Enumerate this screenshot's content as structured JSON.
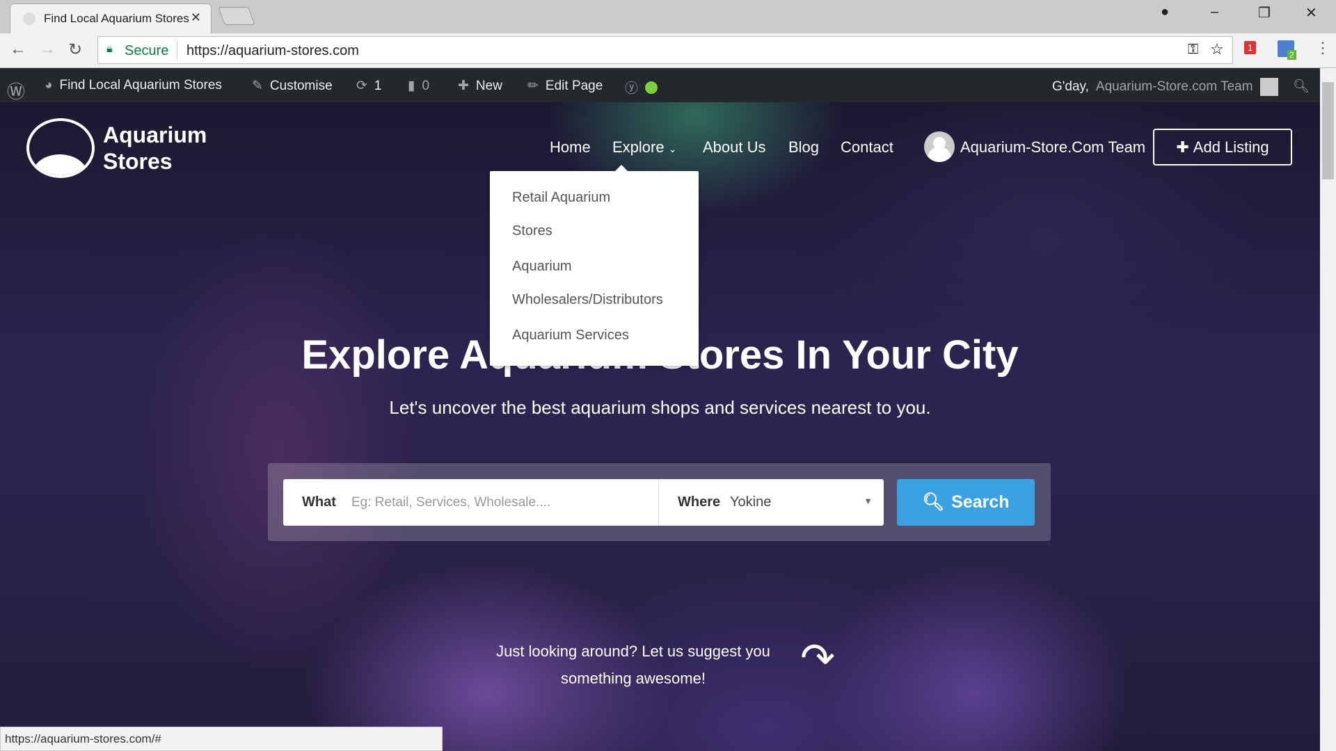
{
  "browser": {
    "tab_title": "Find Local Aquarium Stores",
    "url_secure": "Secure",
    "url": "https://aquarium-stores.com",
    "extension_badge_1": "1",
    "extension_badge_2": "2"
  },
  "wp_admin": {
    "site": "Find Local Aquarium Stores",
    "customise": "Customise",
    "updates": "1",
    "comments": "0",
    "new": "New",
    "edit": "Edit Page",
    "greeting": "G'day,",
    "user": "Aquarium-Store.com Team",
    "status_color": "#7ad03a"
  },
  "site": {
    "logo_line1": "Aquarium",
    "logo_line2": "Stores",
    "nav": [
      {
        "label": "Home"
      },
      {
        "label": "Explore"
      },
      {
        "label": "About Us"
      },
      {
        "label": "Blog"
      },
      {
        "label": "Contact"
      }
    ],
    "account": "Aquarium-Store.Com Team",
    "add_listing": "Add Listing",
    "dropdown": [
      "Retail Aquarium",
      "Stores",
      "Aquarium",
      "Wholesalers/Distributors",
      "Aquarium Services"
    ]
  },
  "hero": {
    "title": "Explore Aquarium Stores In Your City",
    "subtitle": "Let's uncover the best aquarium shops and services nearest to you.",
    "what_label": "What",
    "what_placeholder": "Eg: Retail, Services, Wholesale....",
    "where_label": "Where",
    "where_value": "Yokine",
    "search": "Search",
    "suggest_1": "Just looking around? Let us suggest you",
    "suggest_2": "something awesome!",
    "accent": "#3aa1e3"
  },
  "status_bar": "https://aquarium-stores.com/#"
}
